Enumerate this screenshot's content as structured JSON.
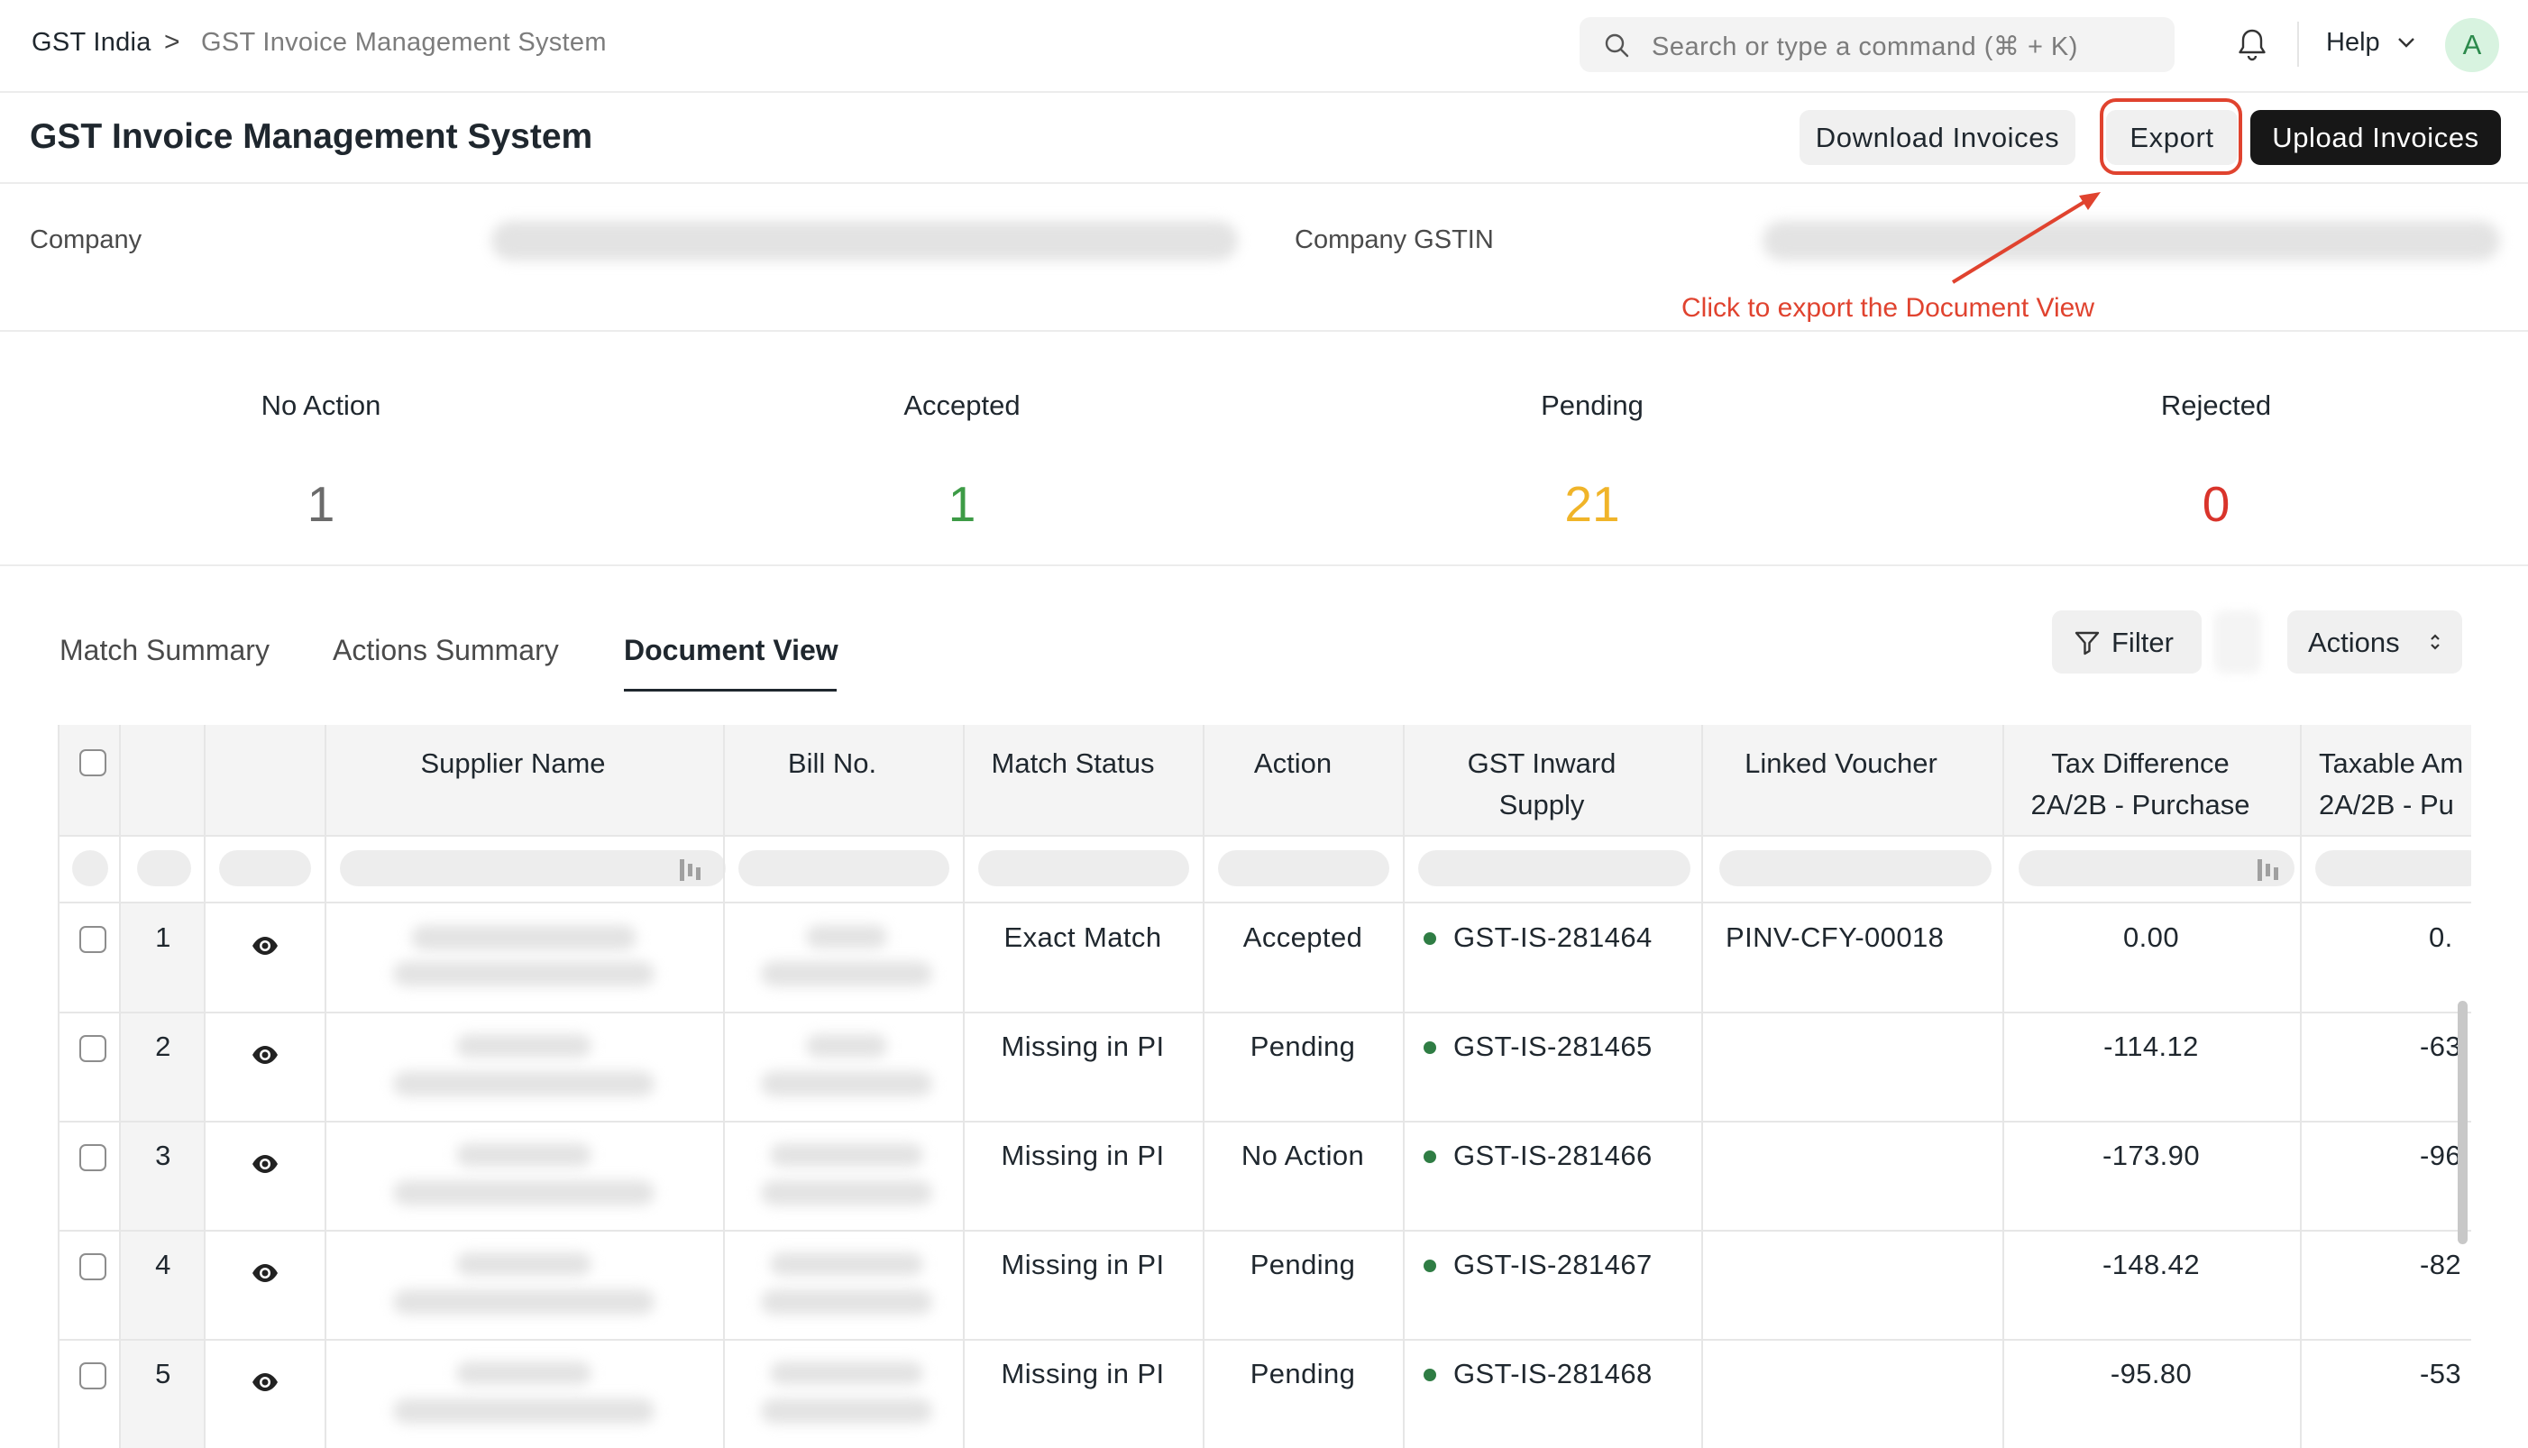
{
  "breadcrumb": {
    "root": "GST India",
    "separator": ">",
    "current": "GST Invoice Management System"
  },
  "search": {
    "placeholder": "Search or type a command (⌘ + K)"
  },
  "topbar": {
    "help_label": "Help",
    "avatar_initial": "A"
  },
  "page": {
    "title": "GST Invoice Management System"
  },
  "toolbar": {
    "download_label": "Download Invoices",
    "export_label": "Export",
    "upload_label": "Upload Invoices"
  },
  "company": {
    "company_label": "Company",
    "gstin_label": "Company GSTIN"
  },
  "annotation": {
    "text": "Click to export the Document View",
    "color": "#e0432f"
  },
  "stats": [
    {
      "label": "No Action",
      "value": "1",
      "color": "#6b6b6b"
    },
    {
      "label": "Accepted",
      "value": "1",
      "color": "#3d9b46"
    },
    {
      "label": "Pending",
      "value": "21",
      "color": "#f0b429"
    },
    {
      "label": "Rejected",
      "value": "0",
      "color": "#d9342b"
    }
  ],
  "tabs": [
    {
      "label": "Match Summary",
      "active": false
    },
    {
      "label": "Actions Summary",
      "active": false
    },
    {
      "label": "Document View",
      "active": true
    }
  ],
  "list_actions": {
    "filter_label": "Filter",
    "actions_label": "Actions"
  },
  "table": {
    "columns": [
      {
        "line1": "Supplier Name",
        "line2": ""
      },
      {
        "line1": "Bill No.",
        "line2": ""
      },
      {
        "line1": "Match Status",
        "line2": ""
      },
      {
        "line1": "Action",
        "line2": ""
      },
      {
        "line1": "GST Inward",
        "line2": "Supply"
      },
      {
        "line1": "Linked Voucher",
        "line2": ""
      },
      {
        "line1": "Tax Difference",
        "line2": "2A/2B - Purchase"
      },
      {
        "line1": "Taxable Am",
        "line2": "2A/2B - Pu"
      }
    ],
    "rows": [
      {
        "no": "1",
        "match_status": "Exact Match",
        "action": "Accepted",
        "gst_inward_supply": "GST-IS-281464",
        "linked_voucher": "PINV-CFY-00018",
        "tax_difference": "0.00",
        "taxable_amount": "0."
      },
      {
        "no": "2",
        "match_status": "Missing in PI",
        "action": "Pending",
        "gst_inward_supply": "GST-IS-281465",
        "linked_voucher": "",
        "tax_difference": "-114.12",
        "taxable_amount": "-63"
      },
      {
        "no": "3",
        "match_status": "Missing in PI",
        "action": "No Action",
        "gst_inward_supply": "GST-IS-281466",
        "linked_voucher": "",
        "tax_difference": "-173.90",
        "taxable_amount": "-96"
      },
      {
        "no": "4",
        "match_status": "Missing in PI",
        "action": "Pending",
        "gst_inward_supply": "GST-IS-281467",
        "linked_voucher": "",
        "tax_difference": "-148.42",
        "taxable_amount": "-82"
      },
      {
        "no": "5",
        "match_status": "Missing in PI",
        "action": "Pending",
        "gst_inward_supply": "GST-IS-281468",
        "linked_voucher": "",
        "tax_difference": "-95.80",
        "taxable_amount": "-53"
      }
    ]
  }
}
